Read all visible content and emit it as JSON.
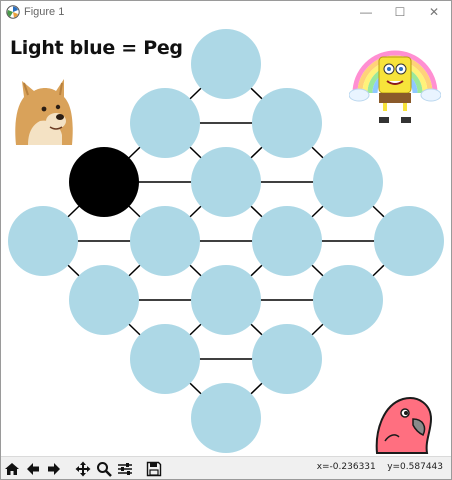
{
  "window": {
    "title": "Figure 1",
    "controls": {
      "minimize": "—",
      "maximize": "☐",
      "close": "✕"
    }
  },
  "figure": {
    "overlay_text": "Light blue = Peg",
    "peg_color": "#add8e6",
    "empty_color": "#000000",
    "line_color": "#000000",
    "holes": [
      {
        "id": "r0c0",
        "state": "peg"
      },
      {
        "id": "r1c0",
        "state": "peg"
      },
      {
        "id": "r1c1",
        "state": "peg"
      },
      {
        "id": "r2c0",
        "state": "empty"
      },
      {
        "id": "r2c1",
        "state": "peg"
      },
      {
        "id": "r2c2",
        "state": "peg"
      },
      {
        "id": "r3c0",
        "state": "peg"
      },
      {
        "id": "r3c1",
        "state": "peg"
      },
      {
        "id": "r3c2",
        "state": "peg"
      },
      {
        "id": "r3c3",
        "state": "peg"
      },
      {
        "id": "r4c0",
        "state": "peg"
      },
      {
        "id": "r4c1",
        "state": "peg"
      },
      {
        "id": "r4c2",
        "state": "peg"
      },
      {
        "id": "r5c0",
        "state": "peg"
      },
      {
        "id": "r5c1",
        "state": "peg"
      },
      {
        "id": "r6c0",
        "state": "peg"
      }
    ],
    "images": [
      "doge-image",
      "spongebob-rainbow-image",
      "party-parrot-image"
    ]
  },
  "toolbar": {
    "buttons": [
      {
        "name": "home-icon",
        "title": "Reset original view"
      },
      {
        "name": "back-icon",
        "title": "Back to previous view"
      },
      {
        "name": "forward-icon",
        "title": "Forward to next view"
      },
      {
        "name": "pan-icon",
        "title": "Pan axes"
      },
      {
        "name": "zoom-icon",
        "title": "Zoom to rectangle"
      },
      {
        "name": "configure-icon",
        "title": "Configure subplots"
      },
      {
        "name": "save-icon",
        "title": "Save the figure"
      }
    ],
    "coords": "x=-0.236331    y=0.587443"
  }
}
